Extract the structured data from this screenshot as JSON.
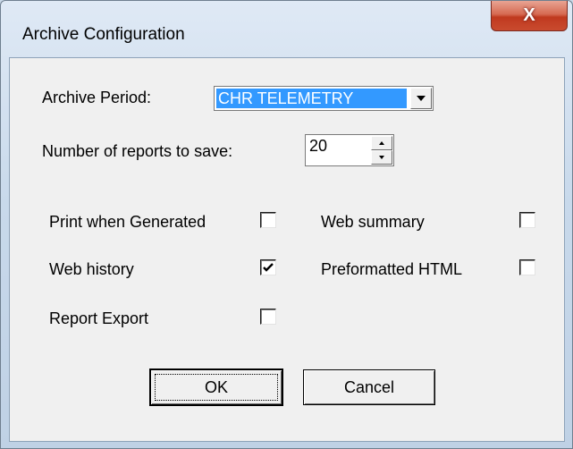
{
  "window": {
    "title": "Archive Configuration",
    "close_glyph": "X"
  },
  "archive_period": {
    "label": "Archive Period:",
    "selected": "CHR TELEMETRY"
  },
  "reports_to_save": {
    "label": "Number of reports to save:",
    "value": "20"
  },
  "options": {
    "print_when_generated": {
      "label": "Print when Generated",
      "checked": false
    },
    "web_summary": {
      "label": "Web summary",
      "checked": false
    },
    "web_history": {
      "label": "Web history",
      "checked": true
    },
    "preformatted_html": {
      "label": "Preformatted HTML",
      "checked": false
    },
    "report_export": {
      "label": "Report Export",
      "checked": false
    }
  },
  "buttons": {
    "ok": "OK",
    "cancel": "Cancel"
  },
  "colors": {
    "selection": "#3399ff",
    "close_button": "#c0391f",
    "dialog_face": "#f0f0f0"
  }
}
